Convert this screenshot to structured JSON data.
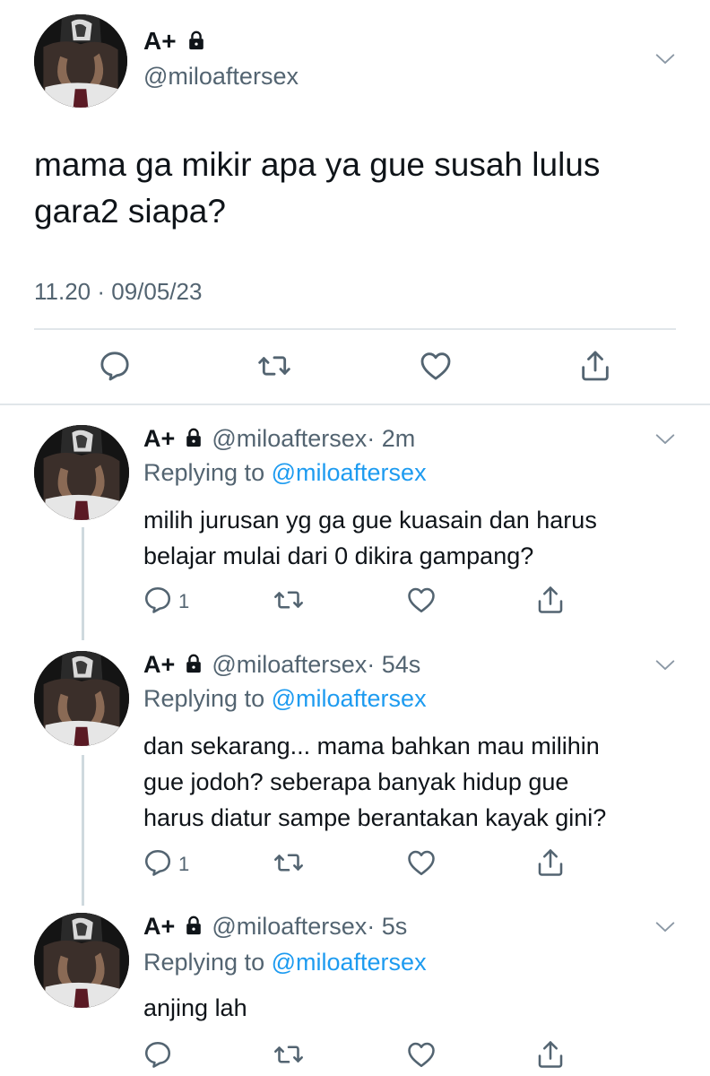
{
  "main_tweet": {
    "display_name": "A+",
    "handle": "@miloaftersex",
    "text_line1": "mama ga mikir apa ya gue susah lulus",
    "text_line2": "gara2 siapa?",
    "timestamp": "11.20 · 09/05/23"
  },
  "replies": [
    {
      "display_name": "A+",
      "handle": "@miloaftersex",
      "time": "· 2m",
      "replying_label": "Replying to",
      "replying_handle": "@miloaftersex",
      "lines": [
        "milih jurusan yg ga gue kuasain dan harus",
        "belajar mulai dari 0 dikira gampang?"
      ],
      "reply_count": "1"
    },
    {
      "display_name": "A+",
      "handle": "@miloaftersex",
      "time": "· 54s",
      "replying_label": "Replying to",
      "replying_handle": "@miloaftersex",
      "lines": [
        "dan sekarang... mama bahkan mau milihin",
        "gue jodoh? seberapa banyak hidup gue",
        "harus diatur sampe berantakan kayak gini?"
      ],
      "reply_count": "1"
    },
    {
      "display_name": "A+",
      "handle": "@miloaftersex",
      "time": "· 5s",
      "replying_label": "Replying to",
      "replying_handle": "@miloaftersex",
      "lines": [
        "anjing lah"
      ],
      "reply_count": ""
    }
  ],
  "icons": {
    "reply": "reply-icon",
    "retweet": "retweet-icon",
    "like": "heart-icon",
    "share": "share-icon",
    "lock": "lock-icon",
    "more": "chevron-down-icon"
  },
  "colors": {
    "text": "#0f1419",
    "secondary": "#536471",
    "link": "#1d9bf0",
    "divider": "#e1e6ea"
  }
}
